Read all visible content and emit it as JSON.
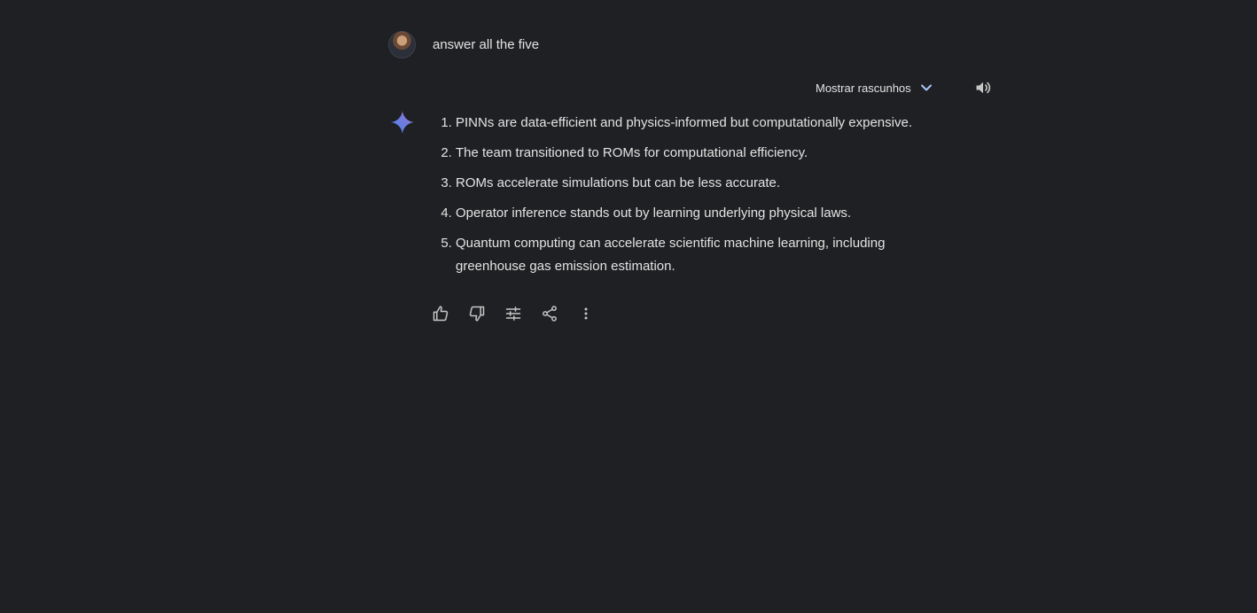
{
  "user": {
    "prompt": "answer all the five"
  },
  "response_header": {
    "drafts_label": "Mostrar rascunhos",
    "drafts_icon": "chevron-down-icon",
    "speaker_icon": "volume-up-icon"
  },
  "response": {
    "items": [
      "PINNs are data-efficient and physics-informed but computationally expensive.",
      "The team transitioned to ROMs for computational efficiency.",
      "ROMs accelerate simulations but can be less accurate.",
      "Operator inference stands out by learning underlying physical laws.",
      "Quantum computing can accelerate scientific machine learning, including greenhouse gas emission estimation."
    ]
  },
  "actions": {
    "icons": [
      "thumb-up-icon",
      "thumb-down-icon",
      "tune-icon",
      "share-icon",
      "more-vertical-icon"
    ]
  },
  "colors": {
    "background": "#1f2023",
    "text": "#e3e3e3",
    "accent": "#a8c7fa",
    "gem_gradient_start": "#4285f4",
    "gem_gradient_end": "#9b72cb"
  }
}
